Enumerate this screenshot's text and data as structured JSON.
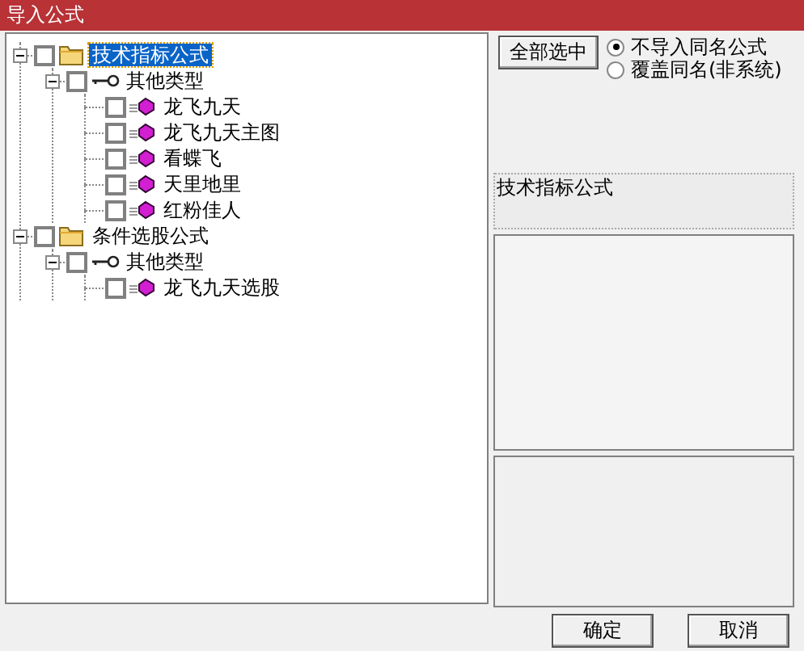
{
  "window": {
    "title": "导入公式"
  },
  "tree": [
    {
      "label": "技术指标公式",
      "kind": "folder",
      "checked": false,
      "expanded": true,
      "selected": true,
      "children": [
        {
          "label": "其他类型",
          "kind": "key",
          "checked": false,
          "expanded": true,
          "selected": false,
          "children": [
            {
              "label": "龙飞九天",
              "kind": "formula",
              "checked": false,
              "selected": false
            },
            {
              "label": "龙飞九天主图",
              "kind": "formula",
              "checked": false,
              "selected": false
            },
            {
              "label": "看蝶飞",
              "kind": "formula",
              "checked": false,
              "selected": false
            },
            {
              "label": "天里地里",
              "kind": "formula",
              "checked": false,
              "selected": false
            },
            {
              "label": "红粉佳人",
              "kind": "formula",
              "checked": false,
              "selected": false
            }
          ]
        }
      ]
    },
    {
      "label": "条件选股公式",
      "kind": "folder",
      "checked": false,
      "expanded": true,
      "selected": false,
      "children": [
        {
          "label": "其他类型",
          "kind": "key",
          "checked": false,
          "expanded": true,
          "selected": false,
          "children": [
            {
              "label": "龙飞九天选股",
              "kind": "formula",
              "checked": false,
              "selected": false
            }
          ]
        }
      ]
    }
  ],
  "select_all_button": "全部选中",
  "options": [
    {
      "label": "不导入同名公式",
      "selected": true
    },
    {
      "label": "覆盖同名(非系统)",
      "selected": false
    }
  ],
  "category_label": "技术指标公式",
  "buttons": [
    "确定",
    "取消"
  ]
}
